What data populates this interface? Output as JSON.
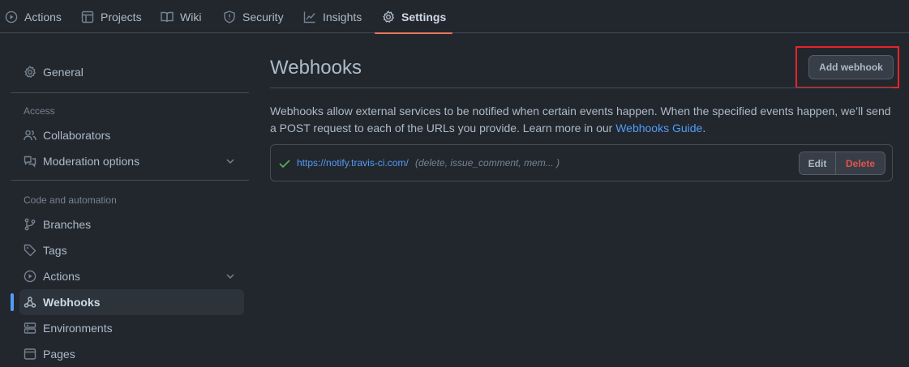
{
  "repo_nav": {
    "tabs": [
      {
        "label": "Actions",
        "icon": "play-icon"
      },
      {
        "label": "Projects",
        "icon": "table-icon"
      },
      {
        "label": "Wiki",
        "icon": "book-icon"
      },
      {
        "label": "Security",
        "icon": "shield-icon"
      },
      {
        "label": "Insights",
        "icon": "graph-icon"
      },
      {
        "label": "Settings",
        "icon": "gear-icon",
        "selected": true
      }
    ]
  },
  "sidebar": {
    "general": {
      "label": "General",
      "icon": "gear-icon"
    },
    "access": {
      "heading": "Access",
      "items": [
        {
          "label": "Collaborators",
          "icon": "people-icon"
        },
        {
          "label": "Moderation options",
          "icon": "report-icon",
          "expandable": true
        }
      ]
    },
    "code_automation": {
      "heading": "Code and automation",
      "items": [
        {
          "label": "Branches",
          "icon": "git-branch-icon"
        },
        {
          "label": "Tags",
          "icon": "tag-icon"
        },
        {
          "label": "Actions",
          "icon": "play-icon",
          "expandable": true
        },
        {
          "label": "Webhooks",
          "icon": "webhook-icon",
          "active": true
        },
        {
          "label": "Environments",
          "icon": "server-icon"
        },
        {
          "label": "Pages",
          "icon": "browser-icon"
        }
      ]
    }
  },
  "main": {
    "title": "Webhooks",
    "add_button": "Add webhook",
    "description_text": "Webhooks allow external services to be notified when certain events happen. When the specified events happen, we’ll send a POST request to each of the URLs you provide. Learn more in our ",
    "description_link": "Webhooks Guide",
    "description_end": ".",
    "webhooks": [
      {
        "status": "check-icon",
        "url": "https://notify.travis-ci.com/",
        "events": "(delete, issue_comment, mem... )",
        "edit_label": "Edit",
        "delete_label": "Delete"
      }
    ]
  },
  "colors": {
    "background": "#22272e",
    "accent": "#539bf5",
    "selected_tab_underline": "#ec775c",
    "success": "#57ab5a",
    "danger": "#e5534b",
    "highlight_box": "#e5252a"
  }
}
